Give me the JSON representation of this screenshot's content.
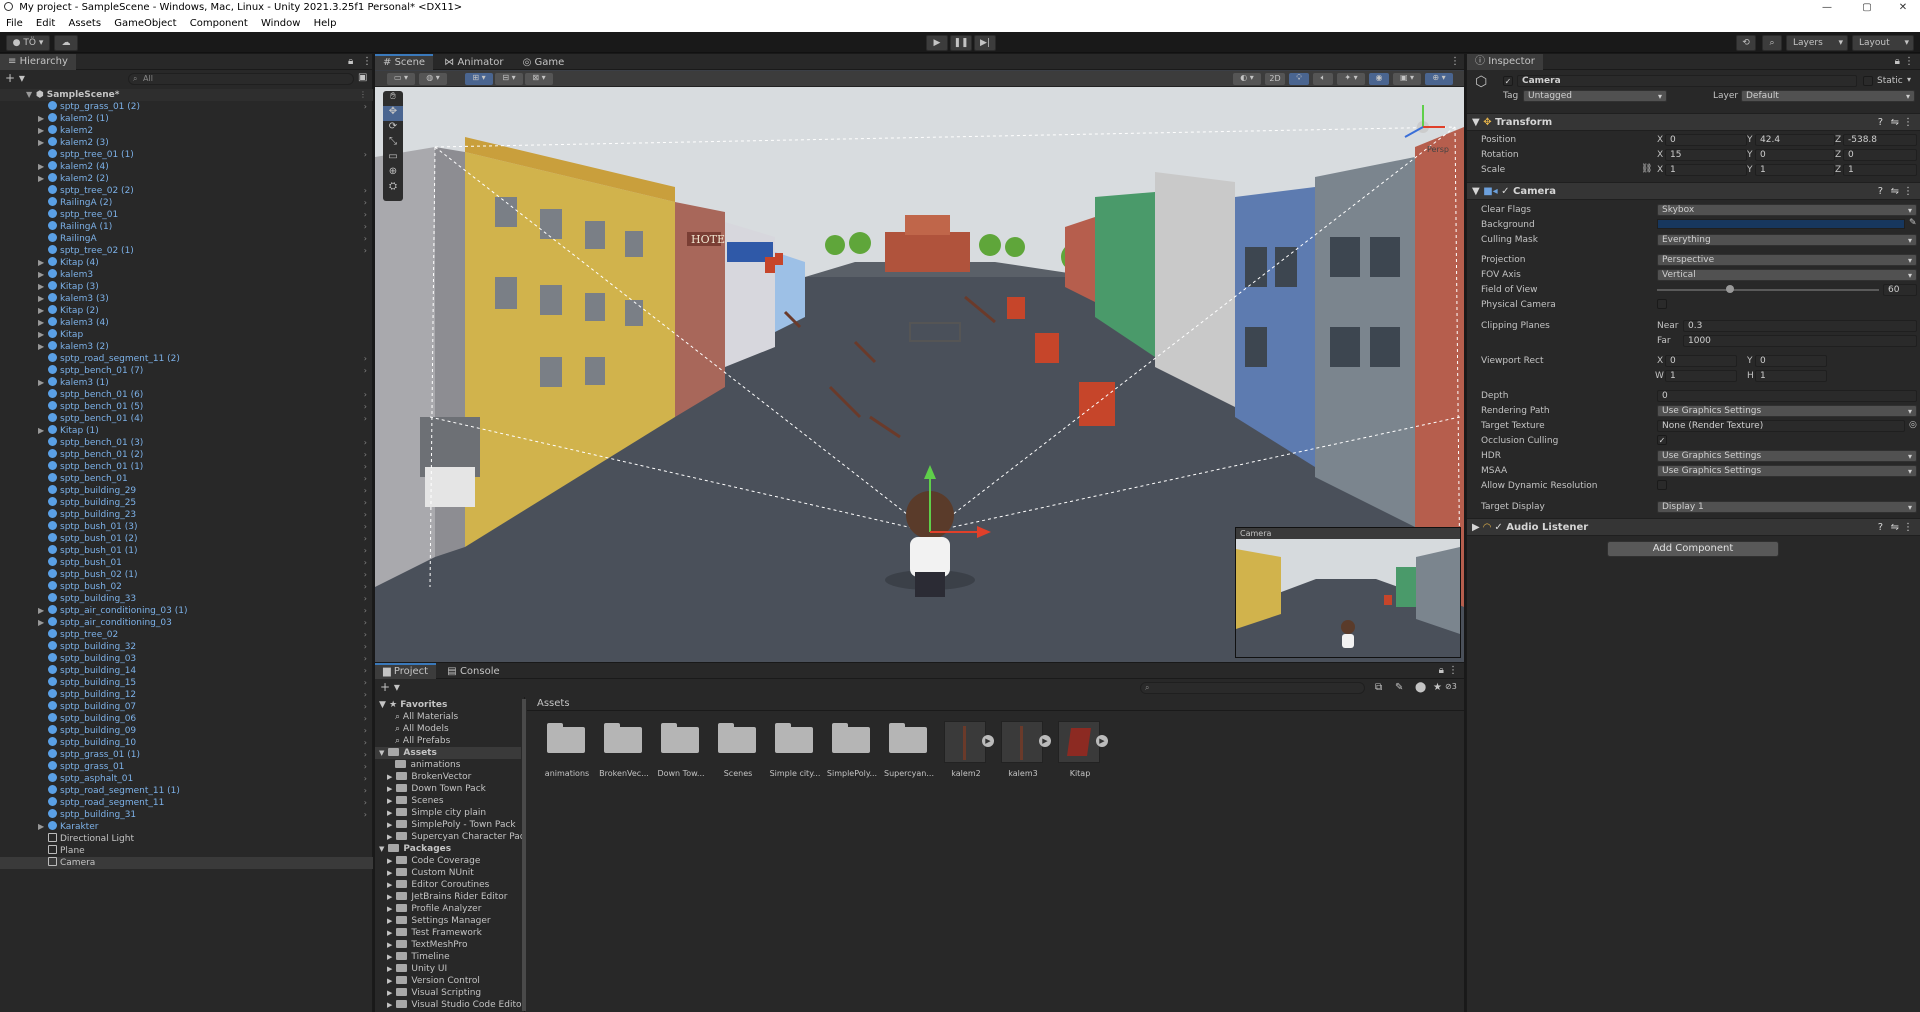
{
  "window": {
    "title": "My project - SampleScene - Windows, Mac, Linux - Unity 2021.3.25f1 Personal* <DX11>"
  },
  "menu": [
    "File",
    "Edit",
    "Assets",
    "GameObject",
    "Component",
    "Window",
    "Help"
  ],
  "toolbar": {
    "account": "TÖ",
    "layers": "Layers",
    "layout": "Layout"
  },
  "hierarchy": {
    "tab": "Hierarchy",
    "search_placeholder": "All",
    "scene": "SampleScene*",
    "items": [
      "sptp_grass_01 (2)",
      "kalem2 (1)",
      "kalem2",
      "kalem2 (3)",
      "sptp_tree_01 (1)",
      "kalem2 (4)",
      "kalem2 (2)",
      "sptp_tree_02 (2)",
      "RailingA (2)",
      "sptp_tree_01",
      "RailingA (1)",
      "RailingA",
      "sptp_tree_02 (1)",
      "Kitap (4)",
      "kalem3",
      "Kitap (3)",
      "kalem3 (3)",
      "Kitap (2)",
      "kalem3 (4)",
      "Kitap",
      "kalem3 (2)",
      "sptp_road_segment_11 (2)",
      "sptp_bench_01 (7)",
      "kalem3 (1)",
      "sptp_bench_01 (6)",
      "sptp_bench_01 (5)",
      "sptp_bench_01 (4)",
      "Kitap (1)",
      "sptp_bench_01 (3)",
      "sptp_bench_01 (2)",
      "sptp_bench_01 (1)",
      "sptp_bench_01",
      "sptp_building_29",
      "sptp_building_25",
      "sptp_building_23",
      "sptp_bush_01 (3)",
      "sptp_bush_01 (2)",
      "sptp_bush_01 (1)",
      "sptp_bush_01",
      "sptp_bush_02 (1)",
      "sptp_bush_02",
      "sptp_building_33",
      "sptp_air_conditioning_03 (1)",
      "sptp_air_conditioning_03",
      "sptp_tree_02",
      "sptp_building_32",
      "sptp_building_03",
      "sptp_building_14",
      "sptp_building_15",
      "sptp_building_12",
      "sptp_building_07",
      "sptp_building_06",
      "sptp_building_09",
      "sptp_building_10",
      "sptp_grass_01 (1)",
      "sptp_grass_01",
      "sptp_asphalt_01",
      "sptp_road_segment_11 (1)",
      "sptp_road_segment_11",
      "sptp_building_31",
      "Karakter",
      "Directional Light",
      "Plane",
      "Camera"
    ]
  },
  "scene_tabs": [
    "Scene",
    "Animator",
    "Game"
  ],
  "scene": {
    "mode_2d": "2D",
    "persp": "Persp",
    "camera_preview": "Camera",
    "hotel_sign": "HOTEL"
  },
  "project": {
    "tabs": [
      "Project",
      "Console"
    ],
    "favorites_title": "Favorites",
    "favorites": [
      "All Materials",
      "All Models",
      "All Prefabs"
    ],
    "assets_title": "Assets",
    "asset_folders": [
      "animations",
      "BrokenVector",
      "Down Town Pack",
      "Scenes",
      "Simple city plain",
      "SimplePoly - Town Pack",
      "Supercyan Character Pac"
    ],
    "packages_title": "Packages",
    "packages": [
      "Code Coverage",
      "Custom NUnit",
      "Editor Coroutines",
      "JetBrains Rider Editor",
      "Profile Analyzer",
      "Settings Manager",
      "Test Framework",
      "TextMeshPro",
      "Timeline",
      "Unity UI",
      "Version Control",
      "Visual Scripting",
      "Visual Studio Code Editor"
    ],
    "breadcrumb": "Assets",
    "grid": [
      "animations",
      "BrokenVec...",
      "Down Tow...",
      "Scenes",
      "Simple city...",
      "SimplePoly...",
      "Supercyan...",
      "kalem2",
      "kalem3",
      "Kitap"
    ],
    "hidden_count": "3"
  },
  "inspector": {
    "tab": "Inspector",
    "object_name": "Camera",
    "static_label": "Static",
    "tag_label": "Tag",
    "tag_value": "Untagged",
    "layer_label": "Layer",
    "layer_value": "Default",
    "transform": {
      "title": "Transform",
      "position_label": "Position",
      "pos_x": "0",
      "pos_y": "42.4",
      "pos_z": "-538.8",
      "rotation_label": "Rotation",
      "rot_x": "15",
      "rot_y": "0",
      "rot_z": "0",
      "scale_label": "Scale",
      "scl_x": "1",
      "scl_y": "1",
      "scl_z": "1"
    },
    "camera": {
      "title": "Camera",
      "clear_flags_label": "Clear Flags",
      "clear_flags": "Skybox",
      "background_label": "Background",
      "background_color": "#17375e",
      "culling_mask_label": "Culling Mask",
      "culling_mask": "Everything",
      "projection_label": "Projection",
      "projection": "Perspective",
      "fov_axis_label": "FOV Axis",
      "fov_axis": "Vertical",
      "fov_label": "Field of View",
      "fov": "60",
      "fov_fraction": 0.33,
      "physical_label": "Physical Camera",
      "clipping_label": "Clipping Planes",
      "near_label": "Near",
      "near": "0.3",
      "far_label": "Far",
      "far": "1000",
      "viewport_label": "Viewport Rect",
      "vp_x": "0",
      "vp_y": "0",
      "vp_w": "1",
      "vp_h": "1",
      "depth_label": "Depth",
      "depth": "0",
      "rendering_path_label": "Rendering Path",
      "rendering_path": "Use Graphics Settings",
      "target_texture_label": "Target Texture",
      "target_texture": "None (Render Texture)",
      "occlusion_label": "Occlusion Culling",
      "hdr_label": "HDR",
      "hdr": "Use Graphics Settings",
      "msaa_label": "MSAA",
      "msaa": "Use Graphics Settings",
      "dynres_label": "Allow Dynamic Resolution",
      "target_display_label": "Target Display",
      "target_display": "Display 1"
    },
    "audio_listener": "Audio Listener",
    "add_component": "Add Component"
  },
  "axis_labels": {
    "x": "X",
    "y": "Y",
    "z": "Z",
    "w": "W",
    "h": "H"
  }
}
